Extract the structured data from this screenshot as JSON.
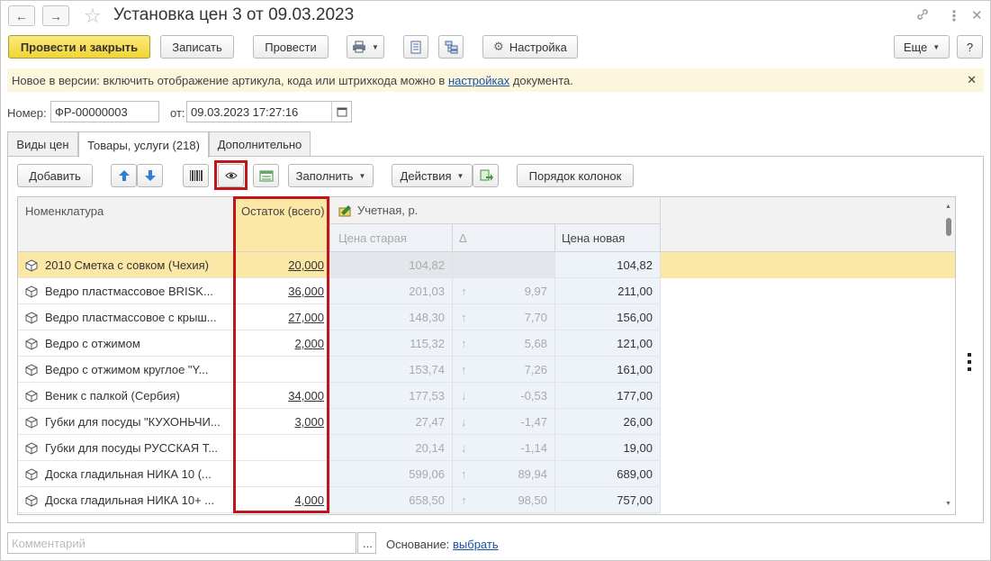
{
  "window": {
    "title": "Установка цен 3 от 09.03.2023",
    "back_icon": "←",
    "forward_icon": "→",
    "star_icon": "☆",
    "link_icon": "🔗",
    "menu_icon": "⋮",
    "close_icon": "✕"
  },
  "toolbar": {
    "post_close": "Провести и закрыть",
    "write": "Записать",
    "post": "Провести",
    "settings": "Настройка",
    "more": "Еще",
    "help": "?"
  },
  "infobar": {
    "text_before": "Новое в версии: включить отображение артикула, кода или штрихкода можно в ",
    "link": "настройках",
    "text_after": " документа."
  },
  "form": {
    "number_label": "Номер:",
    "number_value": "ФР-00000003",
    "date_label": "от:",
    "date_value": "09.03.2023 17:27:16"
  },
  "tabs": [
    {
      "label": "Виды цен"
    },
    {
      "label": "Товары, услуги (218)"
    },
    {
      "label": "Дополнительно"
    }
  ],
  "table_toolbar": {
    "add": "Добавить",
    "fill": "Заполнить",
    "actions": "Действия",
    "column_order": "Порядок колонок"
  },
  "table": {
    "headers": {
      "name": "Номенклатура",
      "stock": "Остаток (всего)",
      "price_group": "Учетная, р.",
      "old_price": "Цена старая",
      "delta": "Δ",
      "new_price": "Цена новая"
    },
    "rows": [
      {
        "name": "2010 Сметка с совком (Чехия)",
        "stock": "20,000",
        "old": "104,82",
        "dir": "",
        "delta": "",
        "new": "104,82"
      },
      {
        "name": "Ведро пластмассовое BRISK...",
        "stock": "36,000",
        "old": "201,03",
        "dir": "↑",
        "delta": "9,97",
        "new": "211,00"
      },
      {
        "name": "Ведро пластмассовое с крыш...",
        "stock": "27,000",
        "old": "148,30",
        "dir": "↑",
        "delta": "7,70",
        "new": "156,00"
      },
      {
        "name": "Ведро с отжимом",
        "stock": "2,000",
        "old": "115,32",
        "dir": "↑",
        "delta": "5,68",
        "new": "121,00"
      },
      {
        "name": "Ведро с отжимом  круглое \"Y...",
        "stock": "",
        "old": "153,74",
        "dir": "↑",
        "delta": "7,26",
        "new": "161,00"
      },
      {
        "name": "Веник с палкой (Сербия)",
        "stock": "34,000",
        "old": "177,53",
        "dir": "↓",
        "delta": "-0,53",
        "new": "177,00"
      },
      {
        "name": "Губки для посуды \"КУХОНЬЧИ...",
        "stock": "3,000",
        "old": "27,47",
        "dir": "↓",
        "delta": "-1,47",
        "new": "26,00"
      },
      {
        "name": "Губки для посуды РУССКАЯ Т...",
        "stock": "",
        "old": "20,14",
        "dir": "↓",
        "delta": "-1,14",
        "new": "19,00"
      },
      {
        "name": "Доска гладильная  НИКА 10 (...",
        "stock": "",
        "old": "599,06",
        "dir": "↑",
        "delta": "89,94",
        "new": "689,00"
      },
      {
        "name": "Доска гладильная  НИКА 10+ ...",
        "stock": "4,000",
        "old": "658,50",
        "dir": "↑",
        "delta": "98,50",
        "new": "757,00"
      }
    ]
  },
  "footer": {
    "comment_placeholder": "Комментарий",
    "ellipsis": "...",
    "basis_label": "Основание:",
    "basis_link": "выбрать"
  },
  "colors": {
    "primary_button": "#f1d534",
    "selected_row": "#fbe8a6",
    "highlight_border": "#c2141b",
    "link": "#1a52a8"
  }
}
